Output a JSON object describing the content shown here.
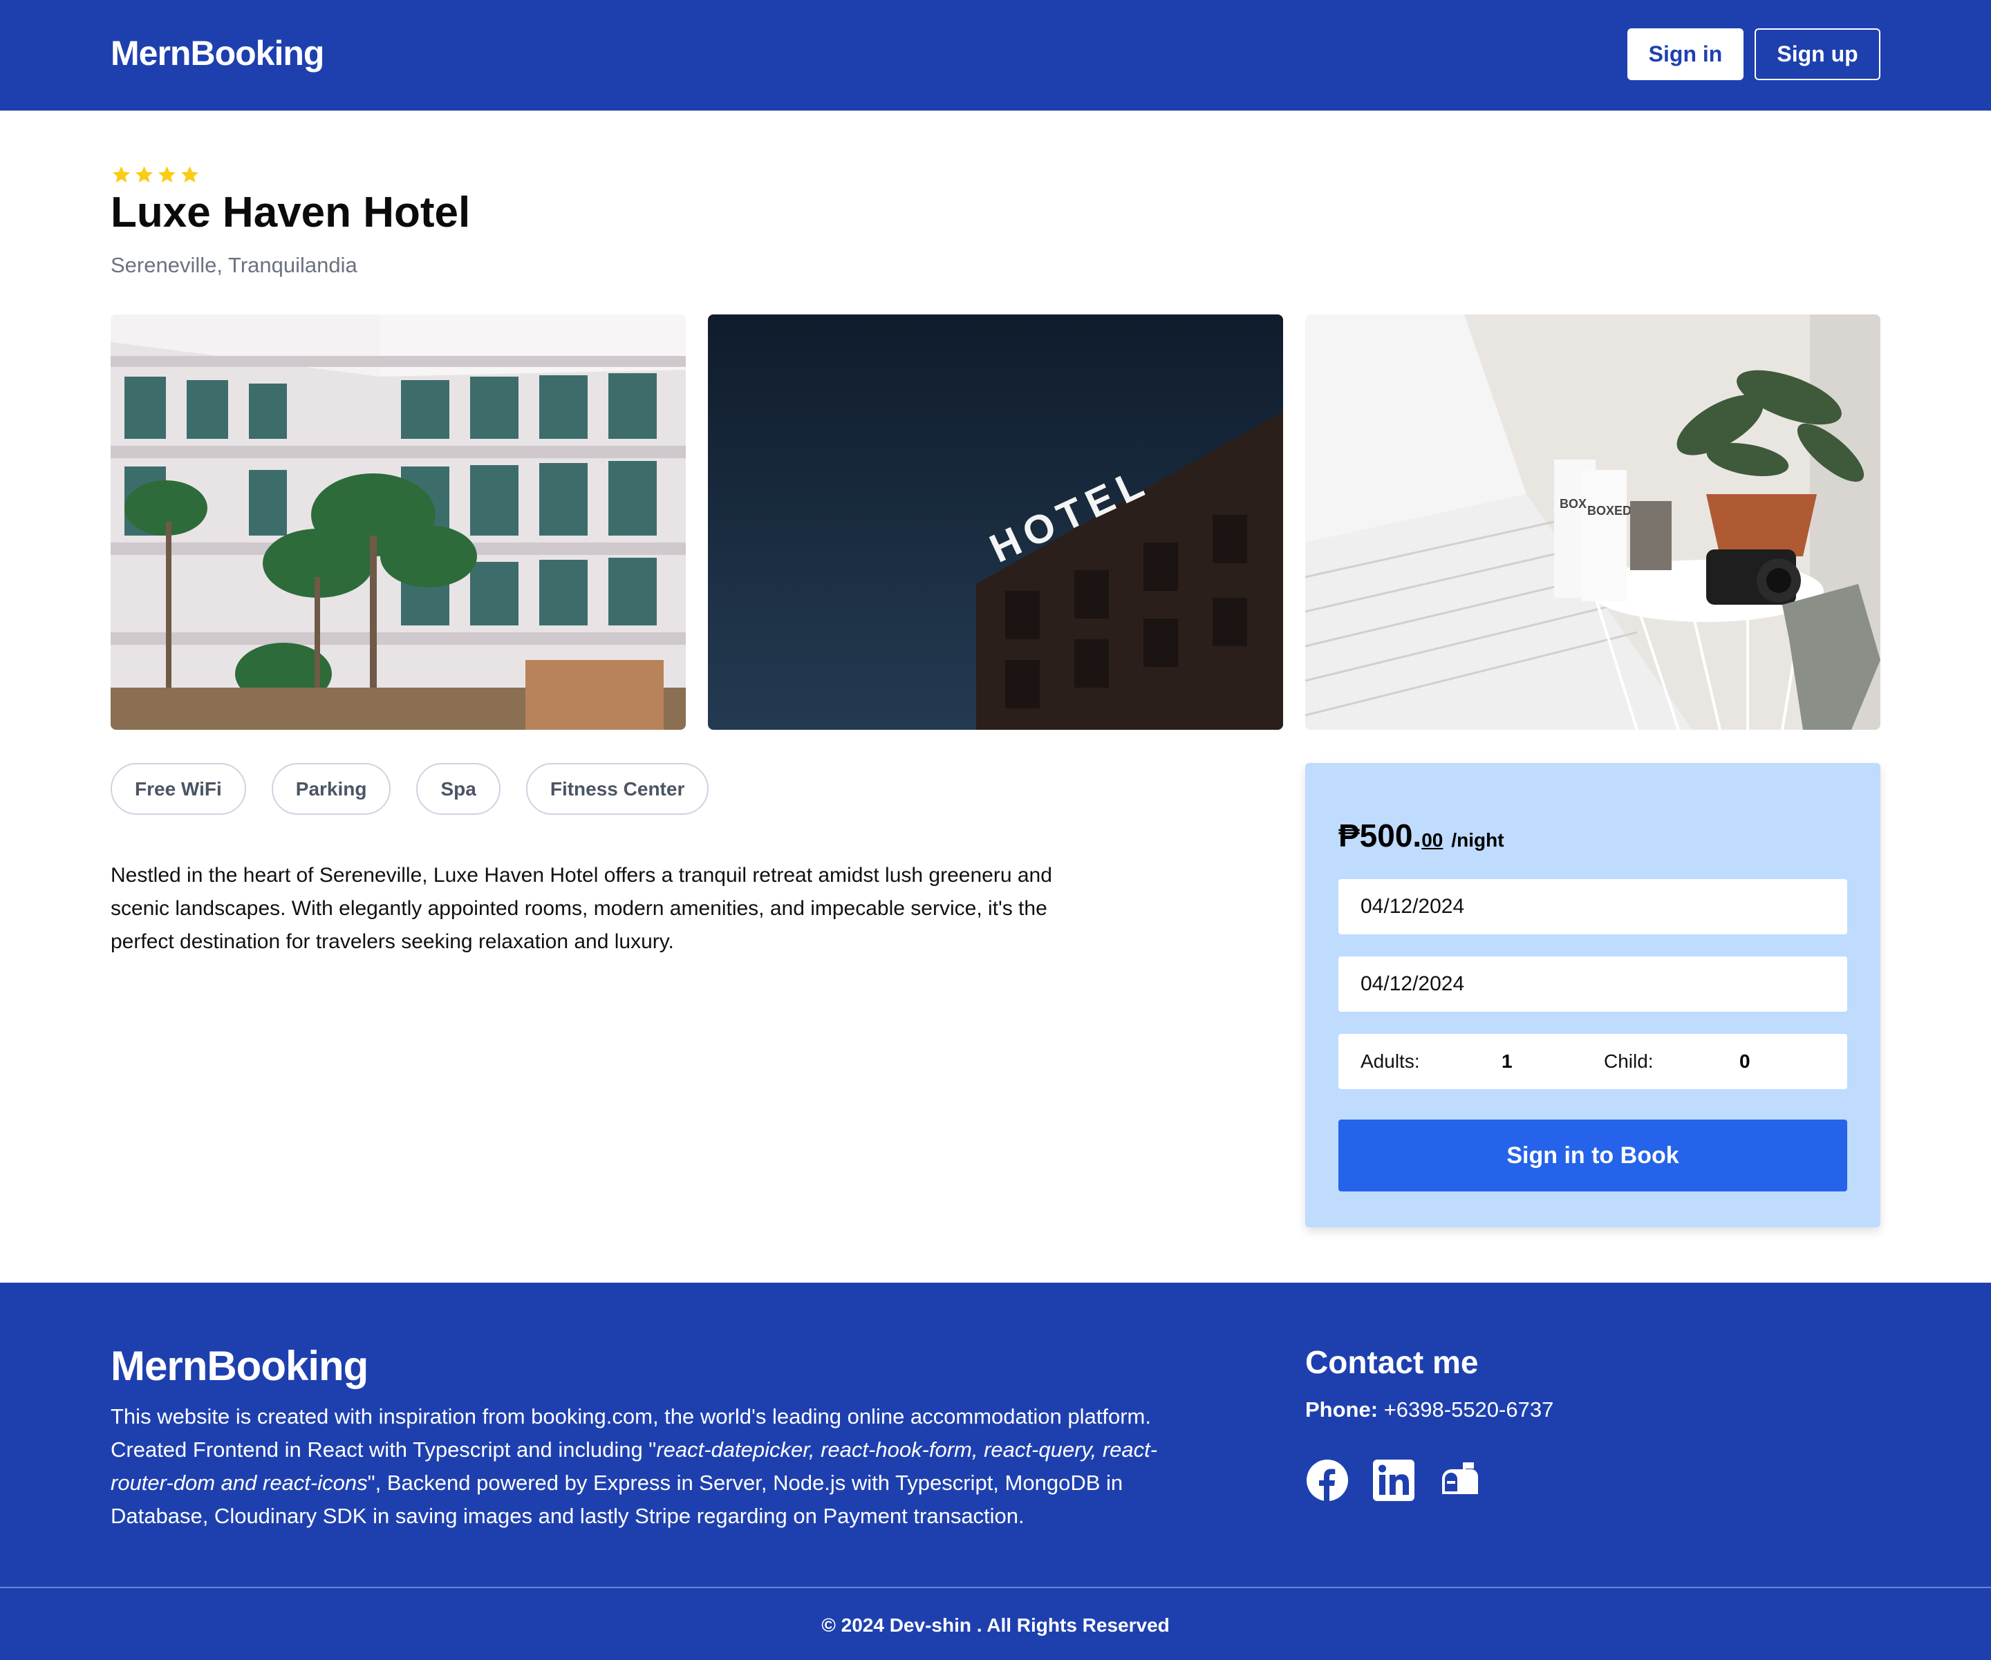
{
  "header": {
    "brand": "MernBooking",
    "signin_label": "Sign in",
    "signup_label": "Sign up"
  },
  "hotel": {
    "star_rating": 4,
    "name": "Luxe Haven Hotel",
    "location": "Sereneville, Tranquilandia",
    "images": [
      "hotel-building-with-palms",
      "hotel-sign-night",
      "bedroom-nightstand-plant-camera"
    ],
    "facilities": [
      "Free WiFi",
      "Parking",
      "Spa",
      "Fitness Center"
    ],
    "description": "Nestled in the heart of Sereneville, Luxe Haven Hotel offers a tranquil retreat amidst lush greeneru and scenic landscapes. With elegantly appointed rooms, modern amenities, and impecable service, it's the perfect destination for travelers seeking relaxation and luxury."
  },
  "booking": {
    "price_main": "₱500.",
    "price_cents": "00",
    "price_unit": "/night",
    "check_in": "04/12/2024",
    "check_out": "04/12/2024",
    "adults_label": "Adults:",
    "adults_value": "1",
    "child_label": "Child:",
    "child_value": "0",
    "book_label": "Sign in to Book"
  },
  "footer": {
    "brand": "MernBooking",
    "desc_1": "This website is created with inspiration from booking.com, the world's leading online accommodation platform. Created Frontend in React with Typescript and including \"",
    "desc_italic": "react-datepicker, react-hook-form, react-query, react-router-dom and react-icons",
    "desc_2": "\", Backend powered by Express in Server, Node.js with Typescript, MongoDB in Database, Cloudinary SDK in saving images and lastly Stripe regarding on Payment transaction.",
    "contact_title": "Contact me",
    "phone_label": "Phone:",
    "phone_value": "+6398-5520-6737",
    "social": [
      "facebook-icon",
      "linkedin-icon",
      "mailbox-icon"
    ],
    "copyright": "© 2024 Dev-shin . All Rights Reserved"
  },
  "colors": {
    "primary": "#1e40af",
    "button": "#2563eb",
    "card": "#bfdbfe",
    "star": "#facc15"
  }
}
